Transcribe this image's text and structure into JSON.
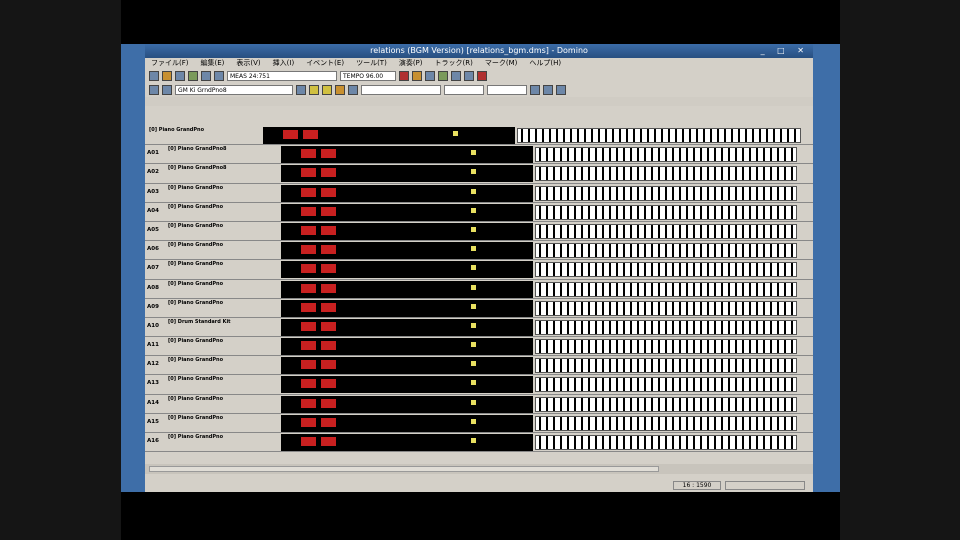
{
  "window": {
    "title": "relations (BGM Version) [relations_bgm.dms] - Domino",
    "controls": "_ □ ✕"
  },
  "menu": [
    "ファイル(F)",
    "編集(E)",
    "表示(V)",
    "挿入(I)",
    "イベント(E)",
    "ツール(T)",
    "演奏(P)",
    "トラック(R)",
    "マーク(M)",
    "ヘルプ(H)"
  ],
  "toolbar": {
    "meas_label": "MEAS",
    "meas_value": "24:751",
    "tempo_label": "TEMPO",
    "tempo_value": "96.00",
    "instrument_select": "GM Ki GrndPno8"
  },
  "tracks": [
    {
      "id": "A01",
      "name": "[0] Piano GrandPno8"
    },
    {
      "id": "A02",
      "name": "[0] Piano GrandPno8"
    },
    {
      "id": "A03",
      "name": "[0] Piano GrandPno"
    },
    {
      "id": "A04",
      "name": "[0] Piano GrandPno"
    },
    {
      "id": "A05",
      "name": "[0] Piano GrandPno"
    },
    {
      "id": "A06",
      "name": "[0] Piano GrandPno"
    },
    {
      "id": "A07",
      "name": "[0] Piano GrandPno"
    },
    {
      "id": "A08",
      "name": "[0] Piano GrandPno"
    },
    {
      "id": "A09",
      "name": "[0] Piano GrandPno"
    },
    {
      "id": "A10",
      "name": "[0] Drum Standard Kit"
    },
    {
      "id": "A11",
      "name": "[0] Piano GrandPno"
    },
    {
      "id": "A12",
      "name": "[0] Piano GrandPno"
    },
    {
      "id": "A13",
      "name": "[0] Piano GrandPno"
    },
    {
      "id": "A14",
      "name": "[0] Piano GrandPno"
    },
    {
      "id": "A15",
      "name": "[0] Piano GrandPno"
    },
    {
      "id": "A16",
      "name": "[0] Piano GrandPno"
    }
  ],
  "master_track": {
    "name": "[0] Piano GrandPno"
  },
  "status": {
    "position": "16 : 1590"
  }
}
